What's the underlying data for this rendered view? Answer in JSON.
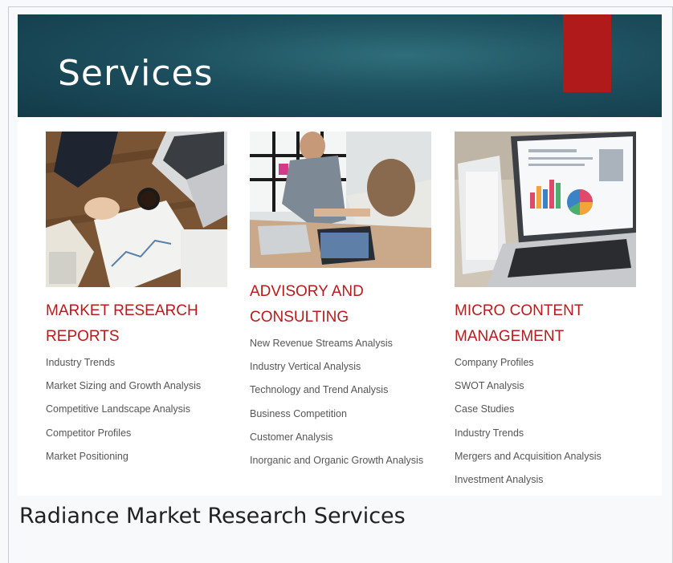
{
  "slide": {
    "title": "Services",
    "columns": [
      {
        "heading": "MARKET RESEARCH REPORTS",
        "image_icon": "desk-documents-laptop-photo",
        "items": [
          "Industry Trends",
          "Market Sizing and Growth Analysis",
          "Competitive Landscape Analysis",
          "Competitor Profiles",
          "Market Positioning"
        ]
      },
      {
        "heading": "ADVISORY AND CONSULTING",
        "image_icon": "handshake-office-photo",
        "items": [
          "New Revenue Streams Analysis",
          "Industry Vertical Analysis",
          "Technology and Trend Analysis",
          "Business Competition",
          "Customer Analysis",
          "Inorganic and Organic Growth Analysis"
        ]
      },
      {
        "heading": "MICRO CONTENT MANAGEMENT",
        "image_icon": "laptop-charts-tablet-photo",
        "items": [
          "Company Profiles",
          "SWOT Analysis",
          "Case Studies",
          "Industry Trends",
          "Mergers and Acquisition Analysis",
          "Investment Analysis"
        ]
      }
    ]
  },
  "caption": "Radiance Market Research Services",
  "colors": {
    "banner": "#1d4f5e",
    "accent": "#b01a1b",
    "heading": "#b71c1c",
    "body_text": "#555555"
  }
}
